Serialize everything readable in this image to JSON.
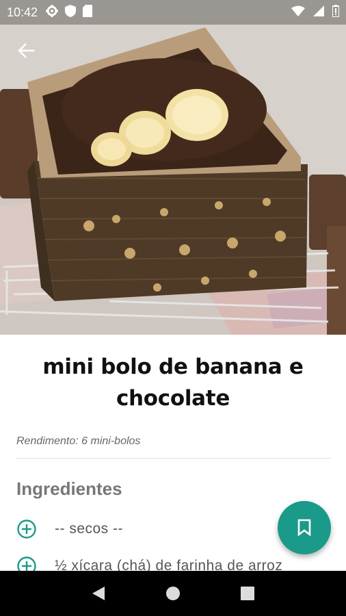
{
  "status_bar": {
    "time": "10:42",
    "left_icons": [
      "gear-icon",
      "shield-icon",
      "sd-card-icon"
    ],
    "right_icons": [
      "wifi-icon",
      "signal-icon",
      "battery-icon"
    ]
  },
  "header": {
    "back_icon": "arrow-left-icon"
  },
  "recipe": {
    "title": "mini bolo de banana e chocolate",
    "yield": "Rendimento: 6 mini-bolos",
    "ingredients_heading": "Ingredientes",
    "ingredients": [
      "-- secos --",
      "½ xícara (chá) de farinha de arroz"
    ]
  },
  "fab": {
    "icon": "bookmark-icon",
    "color": "#1a9a88"
  },
  "accent_color": "#1a9a88",
  "nav_bar": {
    "icons": [
      "back-triangle-icon",
      "home-circle-icon",
      "recents-square-icon"
    ]
  }
}
